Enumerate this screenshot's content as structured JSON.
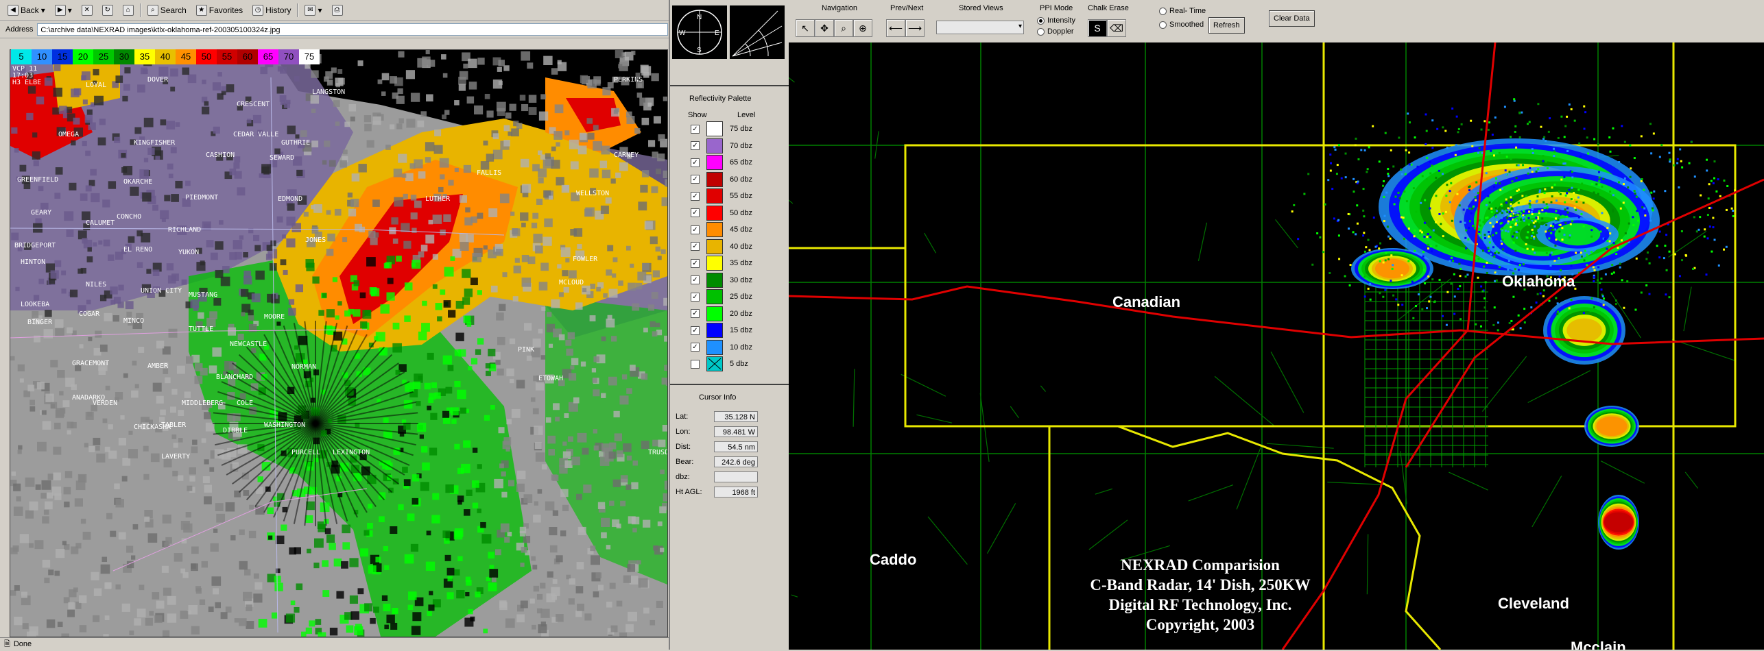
{
  "ie": {
    "toolbar": {
      "back": "Back",
      "search": "Search",
      "favorites": "Favorites",
      "history": "History"
    },
    "address_label": "Address",
    "address_value": "C:\\archive data\\NEXRAD images\\ktlx-oklahoma-ref-200305100324z.jpg",
    "status": "Done",
    "scale_labels": [
      "5",
      "10",
      "15",
      "20",
      "25",
      "30",
      "35",
      "40",
      "45",
      "50",
      "55",
      "60",
      "65",
      "70",
      "75"
    ],
    "scale_colors": [
      "#00e8e8",
      "#3090ff",
      "#0030e0",
      "#00ff00",
      "#00c800",
      "#008800",
      "#ffff00",
      "#e8c000",
      "#ff9000",
      "#ff0000",
      "#d00000",
      "#b00000",
      "#ff00ff",
      "#9050c0",
      "#ffffff"
    ],
    "vcp_info": [
      "VCP 11",
      "17:03",
      "H3 ELBE"
    ],
    "towns": [
      {
        "name": "DOVER"
      },
      {
        "name": "LOYAL"
      },
      {
        "name": "CRESCENT"
      },
      {
        "name": "LANGSTON"
      },
      {
        "name": "PERKINS"
      },
      {
        "name": "OMEGA"
      },
      {
        "name": "KINGFISHER"
      },
      {
        "name": "CEDAR VALLE"
      },
      {
        "name": "GUTHRIE"
      },
      {
        "name": "CASHION"
      },
      {
        "name": "SEWARD"
      },
      {
        "name": "CARNEY"
      },
      {
        "name": "GREENFIELD"
      },
      {
        "name": "OKARCHE"
      },
      {
        "name": "FALLIS"
      },
      {
        "name": "EDMOND"
      },
      {
        "name": "WELLSTON"
      },
      {
        "name": "PIEDMONT"
      },
      {
        "name": "LUTHER"
      },
      {
        "name": "GEARY"
      },
      {
        "name": "CONCHO"
      },
      {
        "name": "CALUMET"
      },
      {
        "name": "RICHLAND"
      },
      {
        "name": "JONES"
      },
      {
        "name": "BRIDGEPORT"
      },
      {
        "name": "EL RENO"
      },
      {
        "name": "YUKON"
      },
      {
        "name": "FOWLER"
      },
      {
        "name": "HINTON"
      },
      {
        "name": "MUSTANG"
      },
      {
        "name": "NILES"
      },
      {
        "name": "UNION CITY"
      },
      {
        "name": "MCLOUD"
      },
      {
        "name": "LOOKEBA"
      },
      {
        "name": "COGAR"
      },
      {
        "name": "MINCO"
      },
      {
        "name": "MOORE"
      },
      {
        "name": "BINGER"
      },
      {
        "name": "TUTTLE"
      },
      {
        "name": "NEWCASTLE"
      },
      {
        "name": "GRACEMONT"
      },
      {
        "name": "AMBER"
      },
      {
        "name": "NORMAN"
      },
      {
        "name": "BLANCHARD"
      },
      {
        "name": "ETOWAH"
      },
      {
        "name": "ANADARKO"
      },
      {
        "name": "VERDEN"
      },
      {
        "name": "MIDDLEBERG"
      },
      {
        "name": "COLE"
      },
      {
        "name": "CHICKASHA"
      },
      {
        "name": "TABLER"
      },
      {
        "name": "DIBBLE"
      },
      {
        "name": "WASHINGTON"
      },
      {
        "name": "PURCELL"
      },
      {
        "name": "LEXINGTON"
      },
      {
        "name": "TRUSDALE"
      },
      {
        "name": "LAVERTY"
      },
      {
        "name": "PINK"
      }
    ]
  },
  "palette": {
    "title": "Reflectivity Palette",
    "show_label": "Show",
    "level_label": "Level",
    "items": [
      {
        "label": "75 dbz",
        "color": "#ffffff",
        "checked": true
      },
      {
        "label": "70 dbz",
        "color": "#9966cc",
        "checked": true
      },
      {
        "label": "65 dbz",
        "color": "#ff00ff",
        "checked": true
      },
      {
        "label": "60 dbz",
        "color": "#c00000",
        "checked": true
      },
      {
        "label": "55 dbz",
        "color": "#e00000",
        "checked": true
      },
      {
        "label": "50 dbz",
        "color": "#ff0000",
        "checked": true
      },
      {
        "label": "45 dbz",
        "color": "#ff8c00",
        "checked": true
      },
      {
        "label": "40 dbz",
        "color": "#e8b400",
        "checked": true
      },
      {
        "label": "35 dbz",
        "color": "#ffff00",
        "checked": true
      },
      {
        "label": "30 dbz",
        "color": "#008c00",
        "checked": true
      },
      {
        "label": "25 dbz",
        "color": "#00c000",
        "checked": true
      },
      {
        "label": "20 dbz",
        "color": "#00ff00",
        "checked": true
      },
      {
        "label": "15 dbz",
        "color": "#0000ff",
        "checked": true
      },
      {
        "label": "10 dbz",
        "color": "#1e90ff",
        "checked": true
      },
      {
        "label": "5 dbz",
        "color": "#00c8c8",
        "checked": false
      }
    ]
  },
  "cursor_info": {
    "title": "Cursor Info",
    "rows": [
      {
        "label": "Lat:",
        "value": "35.128 N"
      },
      {
        "label": "Lon:",
        "value": "98.481 W"
      },
      {
        "label": "Dist:",
        "value": "54.5 nm"
      },
      {
        "label": "Bear:",
        "value": "242.6 deg"
      },
      {
        "label": "dbz:",
        "value": ""
      },
      {
        "label": "Ht AGL:",
        "value": "1968 ft"
      }
    ]
  },
  "compass": {
    "n": "N",
    "s": "S",
    "e": "E",
    "w": "W"
  },
  "right": {
    "toolbar": {
      "navigation": "Navigation",
      "prev_next": "Prev/Next",
      "stored_views": "Stored Views",
      "ppi_mode": "PPI Mode",
      "intensity": "Intensity",
      "doppler": "Doppler",
      "chalk_erase": "Chalk Erase",
      "real_time": "Real- Time",
      "smoothed": "Smoothed",
      "refresh": "Refresh",
      "clear_data": "Clear Data"
    },
    "counties": [
      "Canadian",
      "Oklahoma",
      "Caddo",
      "Cleveland",
      "Mcclain"
    ],
    "copyright": [
      "NEXRAD Comparision",
      "C-Band Radar, 14' Dish, 250KW",
      "Digital RF Technology, Inc.",
      "Copyright, 2003"
    ]
  }
}
